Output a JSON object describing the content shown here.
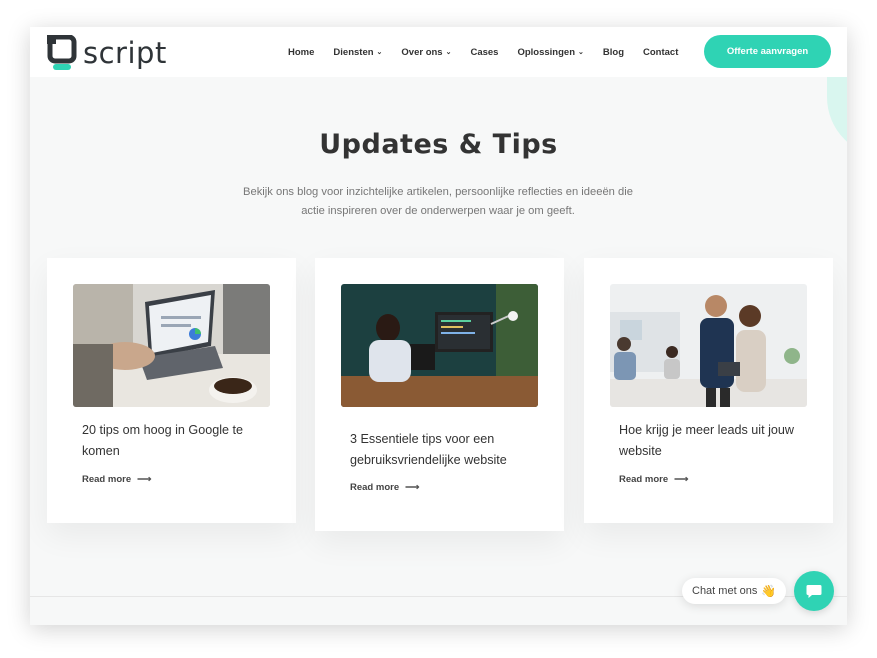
{
  "brand": {
    "name": "script",
    "accent": "#2fd3b4"
  },
  "nav": {
    "items": [
      {
        "label": "Home",
        "dropdown": false
      },
      {
        "label": "Diensten",
        "dropdown": true
      },
      {
        "label": "Over ons",
        "dropdown": true
      },
      {
        "label": "Cases",
        "dropdown": false
      },
      {
        "label": "Oplossingen",
        "dropdown": true
      },
      {
        "label": "Blog",
        "dropdown": false
      },
      {
        "label": "Contact",
        "dropdown": false
      }
    ],
    "cta_label": "Offerte aanvragen"
  },
  "hero": {
    "title": "Updates & Tips",
    "description": "Bekijk ons blog voor inzichtelijke artikelen, persoonlijke reflecties en ideeën die actie inspireren over de onderwerpen waar je om geeft."
  },
  "posts": [
    {
      "title": "20 tips om hoog in Google te komen",
      "read_more": "Read more",
      "image_icon": "laptop-analytics-photo"
    },
    {
      "title": "3 Essentiele tips voor een gebruiksvriendelijke website",
      "read_more": "Read more",
      "image_icon": "developer-desk-photo"
    },
    {
      "title": "Hoe krijg je meer leads uit jouw website",
      "read_more": "Read more",
      "image_icon": "business-people-tablet-photo"
    }
  ],
  "chat": {
    "label": "Chat met ons",
    "emoji": "👋"
  }
}
